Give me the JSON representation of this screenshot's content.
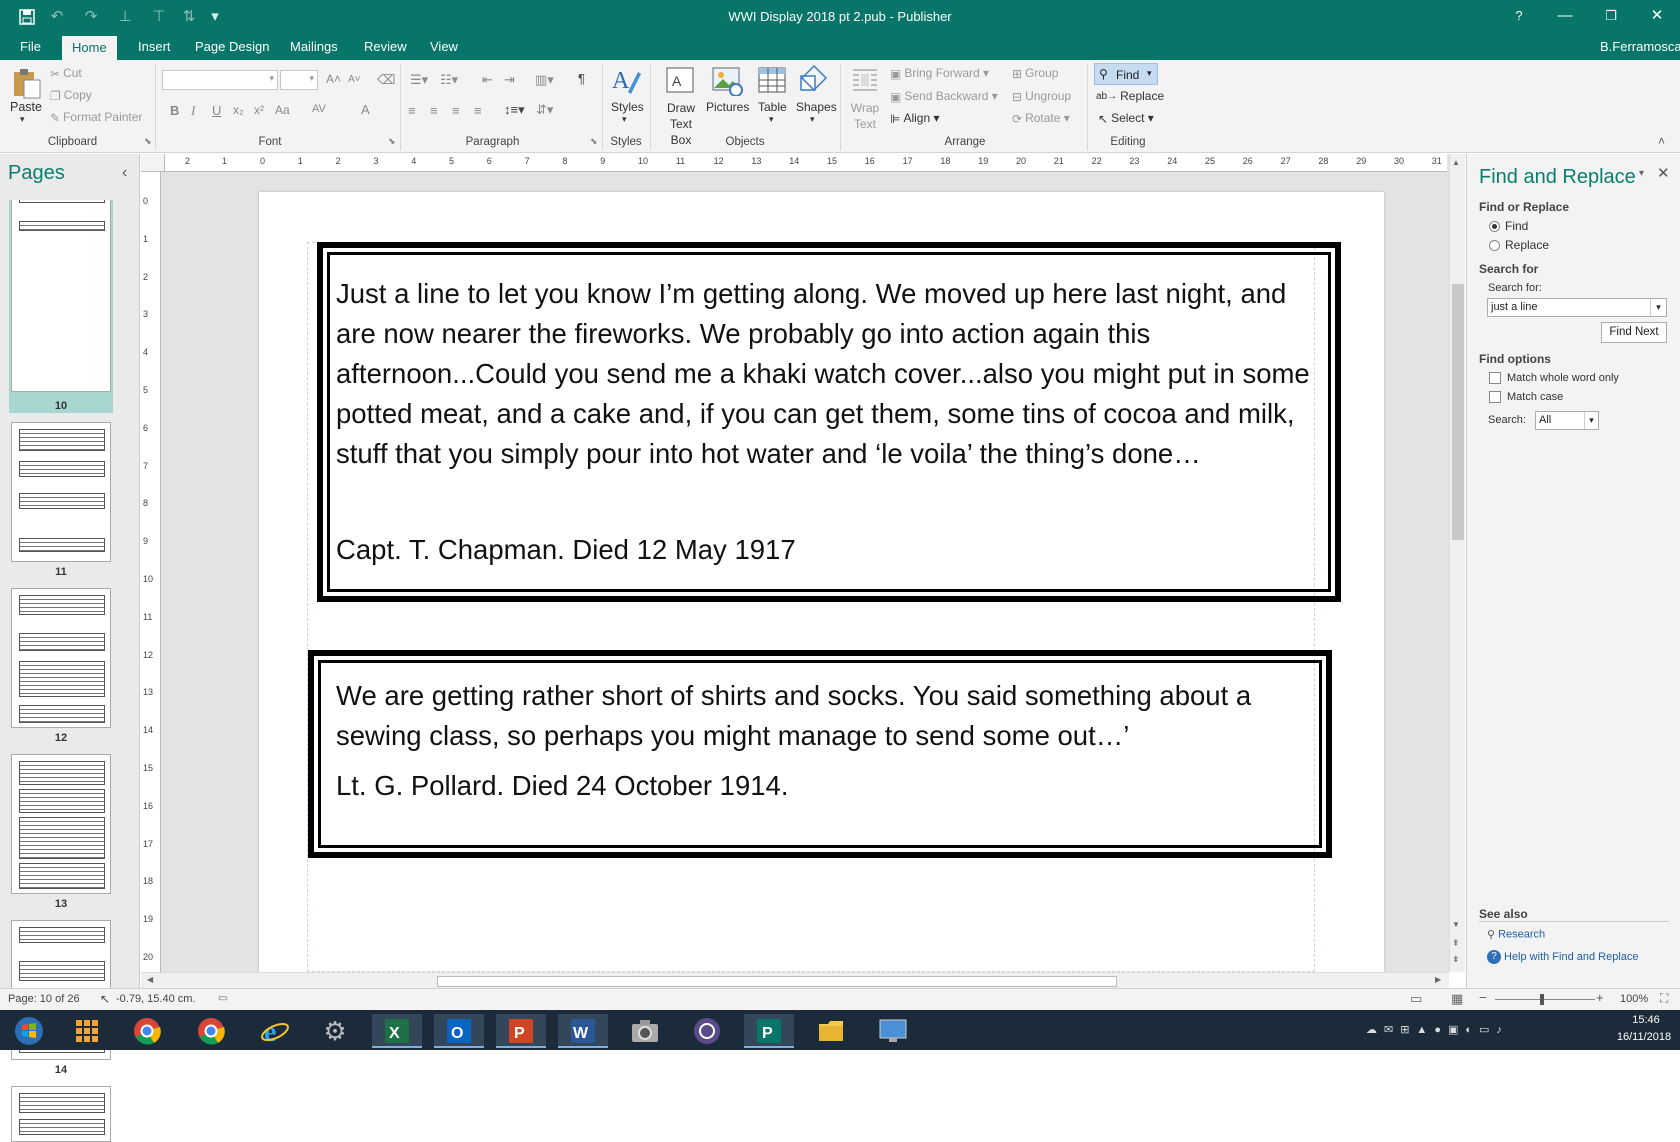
{
  "title": "WWI Display 2018 pt 2.pub - Publisher",
  "help_label": "?",
  "user": "B.Ferramosca",
  "tabs": [
    "File",
    "Home",
    "Insert",
    "Page Design",
    "Mailings",
    "Review",
    "View"
  ],
  "ribbon": {
    "clipboard": {
      "paste": "Paste",
      "cut": "Cut",
      "copy": "Copy",
      "format_painter": "Format Painter",
      "label": "Clipboard"
    },
    "font": {
      "label": "Font",
      "bold": "B",
      "italic": "I",
      "underline": "U",
      "subscript": "x₂",
      "superscript": "x²",
      "change_case": "Aa",
      "char_spacing": "AV",
      "grow": "A",
      "shrink": "A",
      "font_color": "A"
    },
    "paragraph": {
      "label": "Paragraph",
      "marks": "¶"
    },
    "styles": {
      "button": "Styles",
      "label": "Styles"
    },
    "objects": {
      "draw_text_box": "Draw Text Box",
      "pictures": "Pictures",
      "table": "Table",
      "shapes": "Shapes",
      "label": "Objects"
    },
    "arrange": {
      "wrap_text": "Wrap Text",
      "bring_forward": "Bring Forward",
      "send_backward": "Send Backward",
      "align": "Align",
      "group": "Group",
      "ungroup": "Ungroup",
      "rotate": "Rotate",
      "label": "Arrange"
    },
    "editing": {
      "find": "Find",
      "replace": "Replace",
      "select": "Select",
      "label": "Editing"
    }
  },
  "pages_panel": {
    "title": "Pages",
    "collapse": "‹",
    "pages": [
      "10",
      "11",
      "12",
      "13",
      "14"
    ]
  },
  "document": {
    "box1": {
      "quote": "Just a line to let you know I’m getting along. We moved up here last night, and are now nearer the fireworks. We probably go into action again this afternoon...Could you send me a khaki watch cover...also you might put in some potted meat, and a cake and, if you can get them, some tins of cocoa and milk, stuff that you simply pour into hot water and ‘le voila’ the thing’s done…",
      "signature": "Capt. T. Chapman. Died 12 May 1917"
    },
    "box2": {
      "quote": "We are getting rather short of shirts and socks. You said something about a sewing class, so perhaps you might manage to send some out…’",
      "signature": "Lt. G. Pollard. Died 24 October 1914."
    }
  },
  "ruler": {
    "h_left": [
      "2",
      "1"
    ],
    "h": [
      "0",
      "1",
      "2",
      "3",
      "4",
      "5",
      "6",
      "7",
      "8",
      "9",
      "10",
      "11",
      "12",
      "13",
      "14",
      "15",
      "16",
      "17",
      "18",
      "19",
      "20",
      "21",
      "22",
      "23",
      "24",
      "25",
      "26",
      "27",
      "28",
      "29",
      "30",
      "31"
    ],
    "v": [
      "0",
      "1",
      "2",
      "3",
      "4",
      "5",
      "6",
      "7",
      "8",
      "9",
      "10",
      "11",
      "12",
      "13",
      "14",
      "15",
      "16",
      "17",
      "18",
      "19",
      "20"
    ]
  },
  "find_replace": {
    "title": "Find and Replace",
    "close": "✕",
    "find_or_replace_label": "Find or Replace",
    "find_option": "Find",
    "replace_option": "Replace",
    "search_for_section": "Search for",
    "search_for_label": "Search for:",
    "search_value": "just a line",
    "find_next": "Find Next",
    "find_options_label": "Find options",
    "match_whole_word": "Match whole word only",
    "match_case": "Match case",
    "search_label": "Search:",
    "search_scope": "All",
    "see_also": "See also",
    "research": "Research",
    "help": "Help with Find and Replace"
  },
  "status": {
    "page": "Page: 10 of 26",
    "position": "-0.79, 15.40 cm.",
    "zoom": "100%"
  },
  "taskbar": {
    "time": "15:46",
    "date": "16/11/2018"
  },
  "colors": {
    "brand": "#077568",
    "taskbar": "#1c2b3a"
  }
}
